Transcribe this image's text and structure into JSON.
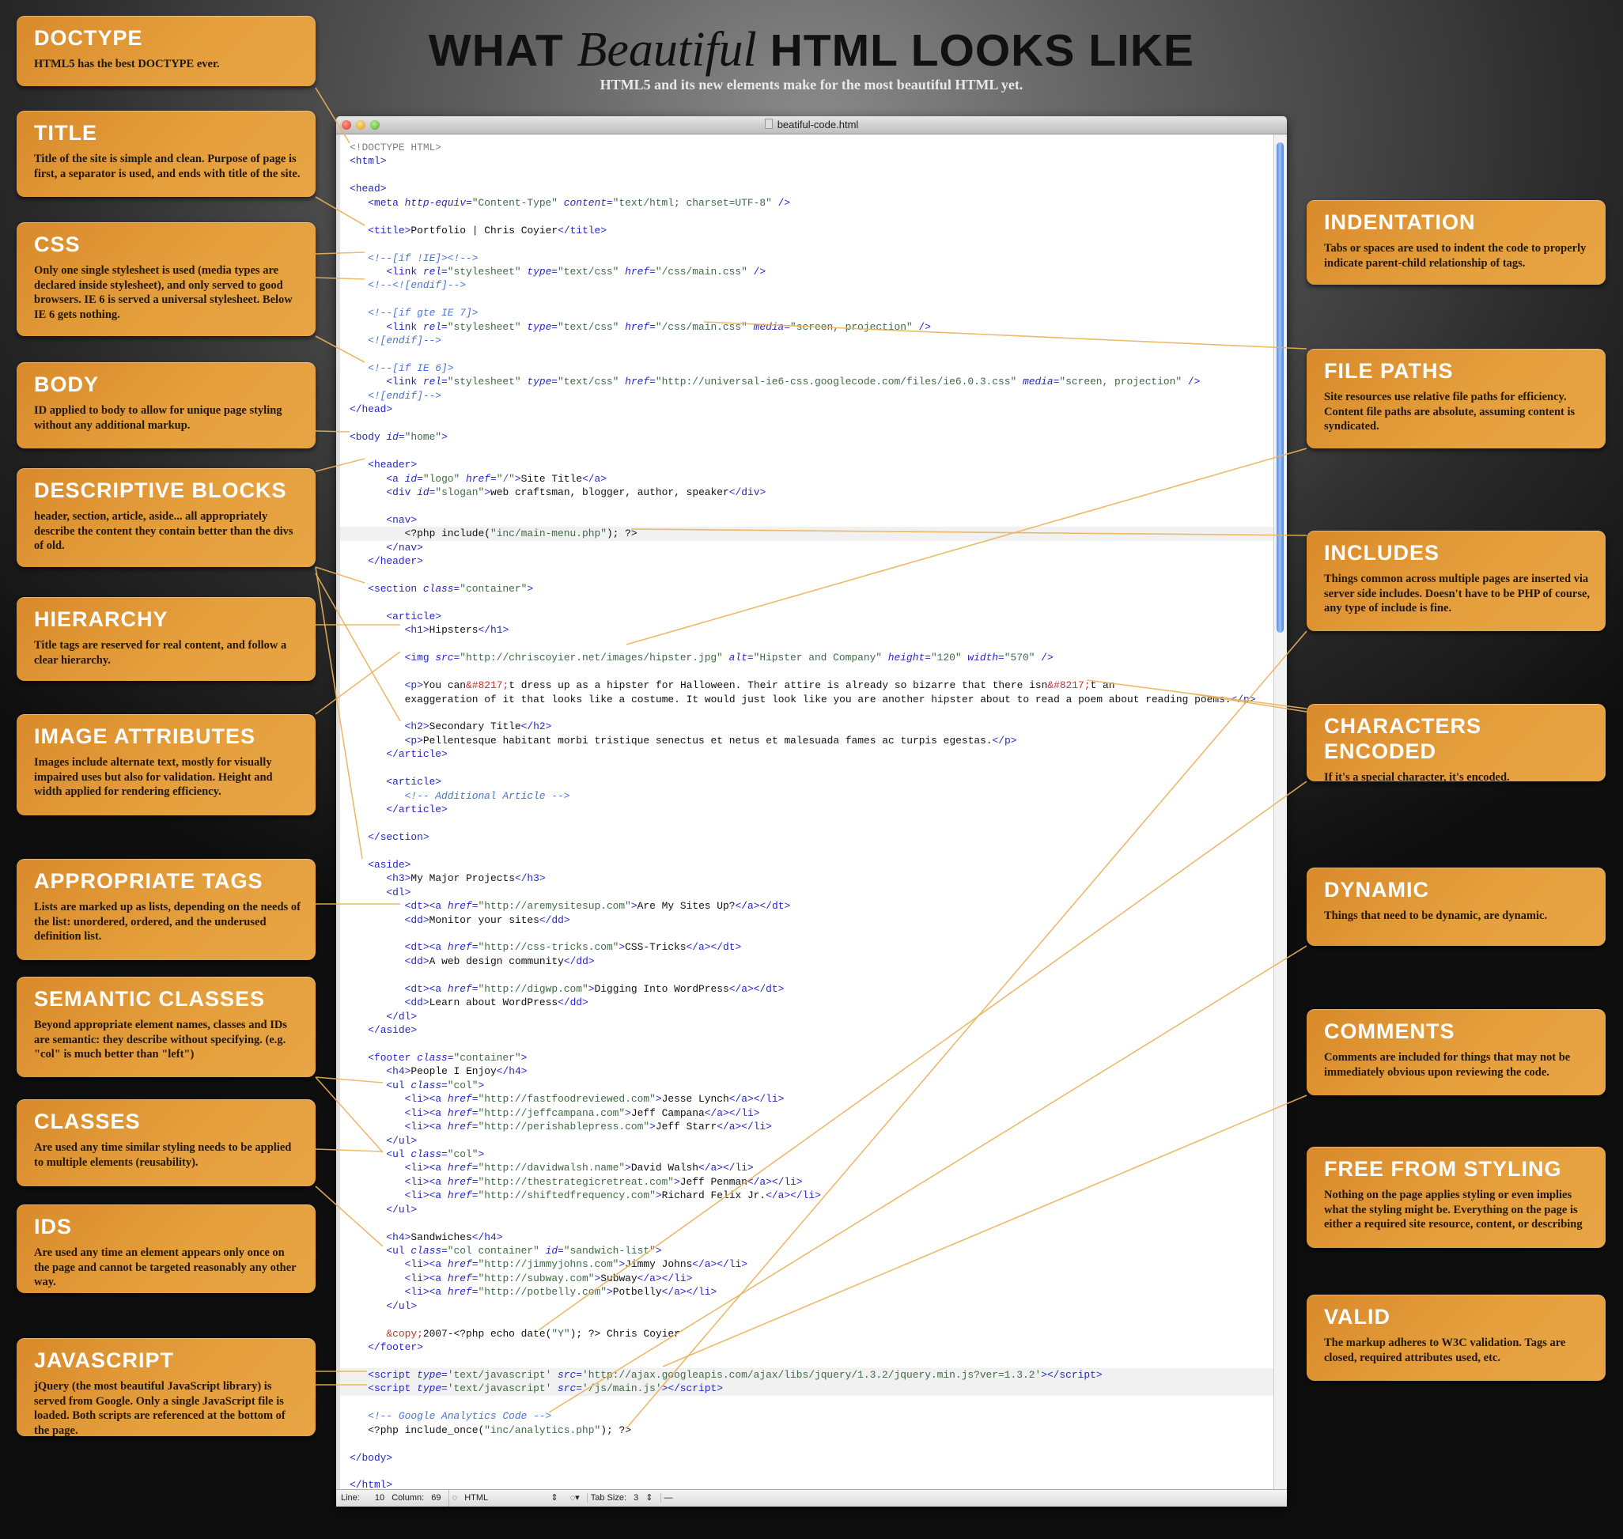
{
  "header": {
    "title_pre": "WHAT",
    "title_em": "Beautiful",
    "title_post": "HTML LOOKS LIKE",
    "subtitle": "HTML5 and its new elements make for the most beautiful HTML yet."
  },
  "colors": {
    "box": "#e29b38",
    "tag": "#2626c9",
    "comment": "#4a72d6",
    "string": "#3f6a45",
    "entity": "#c8302a",
    "connector": "#e9b35a"
  },
  "left_boxes": [
    {
      "title": "DOCTYPE",
      "text": "HTML5 has the best DOCTYPE ever."
    },
    {
      "title": "TITLE",
      "text": "Title of the site is simple and clean. Purpose of page is first, a separator is used, and ends with title of the site."
    },
    {
      "title": "CSS",
      "text": "Only one single stylesheet is used (media types are declared inside stylesheet), and only served to good browsers. IE 6  is served a universal stylesheet. Below IE 6 gets nothing."
    },
    {
      "title": "BODY",
      "text": "ID applied to body to allow for unique page styling without any additional markup."
    },
    {
      "title": "DESCRIPTIVE BLOCKS",
      "text": "header, section, article, aside... all appropriately describe the content they contain better than the divs of old."
    },
    {
      "title": "HIERARCHY",
      "text": "Title tags are reserved for real content, and follow a clear hierarchy."
    },
    {
      "title": "IMAGE ATTRIBUTES",
      "text": "Images include alternate text, mostly for visually impaired uses but also for validation. Height and width applied for rendering efficiency."
    },
    {
      "title": "APPROPRIATE TAGS",
      "text": "Lists are marked up as lists, depending on the needs of the list: unordered, ordered, and the underused definition list."
    },
    {
      "title": "SEMANTIC CLASSES",
      "text": "Beyond appropriate element names, classes and IDs are semantic: they describe without specifying. (e.g. \"col\" is much better than \"left\")"
    },
    {
      "title": "CLASSES",
      "text": "Are used any time similar styling needs to be applied to multiple elements (reusability)."
    },
    {
      "title": "IDS",
      "text": "Are used any time an element appears only once on the page and cannot be targeted reasonably any other way."
    },
    {
      "title": "JAVASCRIPT",
      "text": "jQuery (the most beautiful JavaScript library) is served from Google. Only a single JavaScript file is loaded. Both scripts are referenced at the bottom of the page."
    }
  ],
  "right_boxes": [
    {
      "title": "INDENTATION",
      "text": "Tabs or spaces are used to indent the code to properly indicate parent-child relationship of tags."
    },
    {
      "title": "FILE PATHS",
      "text": "Site resources use relative file paths for efficiency. Content file paths are absolute, assuming content is syndicated."
    },
    {
      "title": "INCLUDES",
      "text": "Things common across multiple pages are inserted via server side includes. Doesn't have to be PHP of course, any type of include is fine."
    },
    {
      "title": "CHARACTERS ENCODED",
      "text": "If it's a special character, it's encoded."
    },
    {
      "title": "DYNAMIC",
      "text": "Things that need to be dynamic, are dynamic."
    },
    {
      "title": "COMMENTS",
      "text": "Comments are included for things that may not be immediately obvious upon reviewing the code."
    },
    {
      "title": "FREE FROM STYLING",
      "text": "Nothing on the page applies styling or even implies what the styling might be. Everything on the page is either a required site resource, content, or describing"
    },
    {
      "title": "VALID",
      "text": "The markup adheres to W3C validation. Tags are closed, required attributes used, etc."
    }
  ],
  "editor": {
    "filename": "beatiful-code.html",
    "status": {
      "line_label": "Line:",
      "line": "10",
      "column_label": "Column:",
      "column": "69",
      "language": "HTML",
      "tab_label": "Tab Size:",
      "tab_size": "3",
      "symbol": "—"
    },
    "highlighted_lines": [
      29,
      90,
      91
    ],
    "lines": [
      "<!DOCTYPE HTML>",
      "<html>",
      "",
      "<head>",
      "   <meta http-equiv=\"Content-Type\" content=\"text/html; charset=UTF-8\" />",
      "",
      "   <title>Portfolio | Chris Coyier</title>",
      "",
      "   <!--[if !IE]><!-->",
      "      <link rel=\"stylesheet\" type=\"text/css\" href=\"/css/main.css\" />",
      "   <!--<![endif]-->",
      "",
      "   <!--[if gte IE 7]>",
      "      <link rel=\"stylesheet\" type=\"text/css\" href=\"/css/main.css\" media=\"screen, projection\" />",
      "   <![endif]-->",
      "",
      "   <!--[if IE 6]>",
      "      <link rel=\"stylesheet\" type=\"text/css\" href=\"http://universal-ie6-css.googlecode.com/files/ie6.0.3.css\" media=\"screen, projection\" />",
      "   <![endif]-->",
      "</head>",
      "",
      "<body id=\"home\">",
      "",
      "   <header>",
      "      <a id=\"logo\" href=\"/\">Site Title</a>",
      "      <div id=\"slogan\">web craftsman, blogger, author, speaker</div>",
      "",
      "      <nav>",
      "         <?php include(\"inc/main-menu.php\"); ?>",
      "      </nav>",
      "   </header>",
      "",
      "   <section class=\"container\">",
      "",
      "      <article>",
      "         <h1>Hipsters</h1>",
      "",
      "         <img src=\"http://chriscoyier.net/images/hipster.jpg\" alt=\"Hipster and Company\" height=\"120\" width=\"570\" />",
      "",
      "         <p>You can&#8217;t dress up as a hipster for Halloween. Their attire is already so bizarre that there isn&#8217;t an",
      "         exaggeration of it that looks like a costume. It would just look like you are another hipster about to read a poem about reading poems.</p>",
      "",
      "         <h2>Secondary Title</h2>",
      "         <p>Pellentesque habitant morbi tristique senectus et netus et malesuada fames ac turpis egestas.</p>",
      "      </article>",
      "",
      "      <article>",
      "         <!-- Additional Article -->",
      "      </article>",
      "",
      "   </section>",
      "",
      "   <aside>",
      "      <h3>My Major Projects</h3>",
      "      <dl>",
      "         <dt><a href=\"http://aremysitesup.com\">Are My Sites Up?</a></dt>",
      "         <dd>Monitor your sites</dd>",
      "",
      "         <dt><a href=\"http://css-tricks.com\">CSS-Tricks</a></dt>",
      "         <dd>A web design community</dd>",
      "",
      "         <dt><a href=\"http://digwp.com\">Digging Into WordPress</a></dt>",
      "         <dd>Learn about WordPress</dd>",
      "      </dl>",
      "   </aside>",
      "",
      "   <footer class=\"container\">",
      "      <h4>People I Enjoy</h4>",
      "      <ul class=\"col\">",
      "         <li><a href=\"http://fastfoodreviewed.com\">Jesse Lynch</a></li>",
      "         <li><a href=\"http://jeffcampana.com\">Jeff Campana</a></li>",
      "         <li><a href=\"http://perishablepress.com\">Jeff Starr</a></li>",
      "      </ul>",
      "      <ul class=\"col\">",
      "         <li><a href=\"http://davidwalsh.name\">David Walsh</a></li>",
      "         <li><a href=\"http://thestrategicretreat.com\">Jeff Penman</a></li>",
      "         <li><a href=\"http://shiftedfrequency.com\">Richard Felix Jr.</a></li>",
      "      </ul>",
      "",
      "      <h4>Sandwiches</h4>",
      "      <ul class=\"col container\" id=\"sandwich-list\">",
      "         <li><a href=\"http://jimmyjohns.com\">Jimmy Johns</a></li>",
      "         <li><a href=\"http://subway.com\">Subway</a></li>",
      "         <li><a href=\"http://potbelly.com\">Potbelly</a></li>",
      "      </ul>",
      "",
      "      &copy;2007-<?php echo date(\"Y\"); ?> Chris Coyier",
      "   </footer>",
      "",
      "   <script type='text/javascript' src='http://ajax.googleapis.com/ajax/libs/jquery/1.3.2/jquery.min.js?ver=1.3.2'></script>",
      "   <script type='text/javascript' src='/js/main.js'></script>",
      "",
      "   <!-- Google Analytics Code -->",
      "   <?php include_once(\"inc/analytics.php\"); ?>",
      "",
      "</body>",
      "",
      "</html>"
    ]
  }
}
